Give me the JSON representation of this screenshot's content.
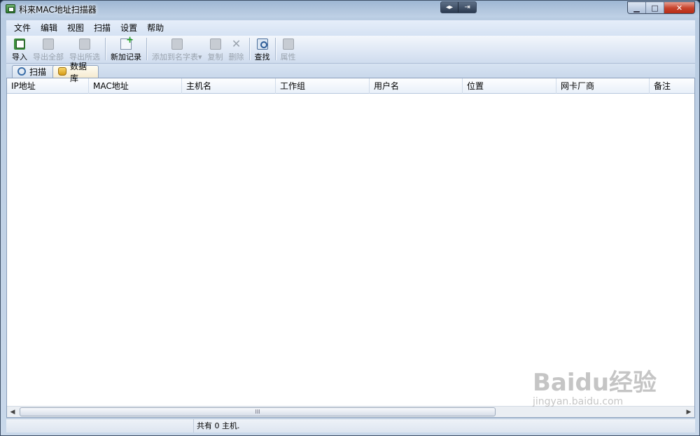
{
  "window": {
    "title": "科来MAC地址扫描器",
    "aux_buttons": [
      "◂▸",
      "⇥"
    ],
    "caption_buttons": {
      "minimize": "▁",
      "maximize": "□",
      "close": "✕"
    }
  },
  "menu": [
    "文件",
    "编辑",
    "视图",
    "扫描",
    "设置",
    "帮助"
  ],
  "toolbar": [
    {
      "label": "导入",
      "icon": "import-icon",
      "enabled": true
    },
    {
      "label": "导出全部",
      "icon": "export-all-icon",
      "enabled": false
    },
    {
      "label": "导出所选",
      "icon": "export-selected-icon",
      "enabled": false
    },
    {
      "label": "新加记录",
      "icon": "new-record-icon",
      "enabled": true
    },
    {
      "label": "添加到名字表▾",
      "icon": "add-to-name-table-icon",
      "enabled": false
    },
    {
      "label": "复制",
      "icon": "copy-icon",
      "enabled": false
    },
    {
      "label": "删除",
      "icon": "delete-icon",
      "enabled": false
    },
    {
      "label": "查找",
      "icon": "find-icon",
      "enabled": true
    },
    {
      "label": "属性",
      "icon": "properties-icon",
      "enabled": false
    }
  ],
  "tabs": [
    {
      "label": "扫描",
      "icon": "magnifier-icon",
      "active": false
    },
    {
      "label": "数据库",
      "icon": "database-icon",
      "active": true
    }
  ],
  "table": {
    "columns": [
      "IP地址",
      "MAC地址",
      "主机名",
      "工作组",
      "用户名",
      "位置",
      "网卡厂商",
      "备注"
    ],
    "rows": []
  },
  "scrollbar": {
    "thumb_glyph": "III"
  },
  "status": {
    "pane1": "",
    "pane2": "共有 0 主机."
  },
  "watermark": {
    "brand": "Baidu经验",
    "url": "jingyan.baidu.com"
  }
}
